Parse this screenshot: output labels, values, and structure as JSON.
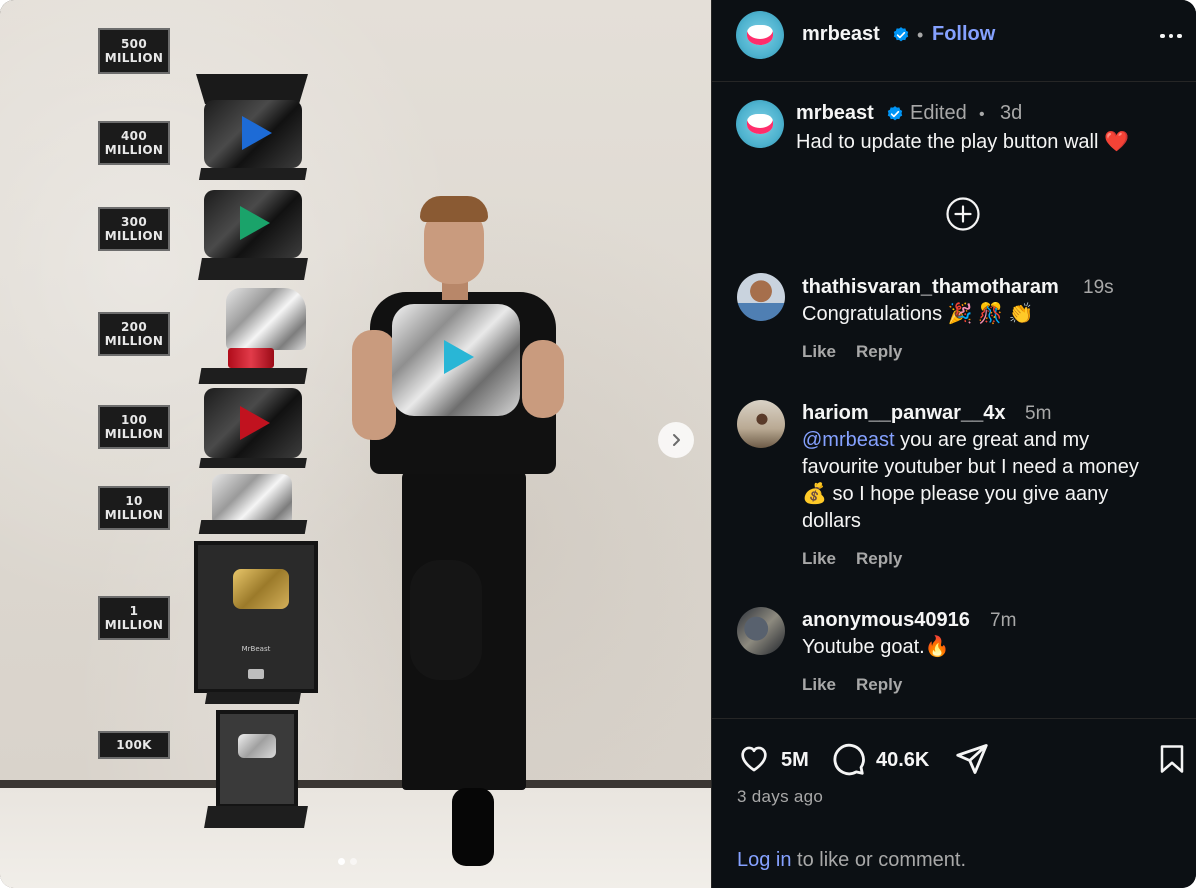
{
  "header": {
    "username": "mrbeast",
    "separator": "•",
    "follow_label": "Follow"
  },
  "media": {
    "plaques": [
      "500\nMILLION",
      "400\nMILLION",
      "300\nMILLION",
      "200\nMILLION",
      "100\nMILLION",
      "10\nMILLION",
      "1\nMILLION",
      "100K"
    ],
    "frame_label": "MrBeast",
    "slide_index": 1,
    "slide_count": 2
  },
  "caption": {
    "username": "mrbeast",
    "edited_label": "Edited",
    "separator": "•",
    "time": "3d",
    "text": "Had to update the play button wall ❤️"
  },
  "comments": [
    {
      "username": "thathisvaran_thamotharam",
      "time": "19s",
      "text": "Congratulations 🎉 🎊 👏",
      "like_label": "Like",
      "reply_label": "Reply"
    },
    {
      "username": "hariom__panwar__4x",
      "time": "5m",
      "mention": "@mrbeast",
      "text_line1": " you are great and my",
      "text_line2": "favourite youtuber but I need a money",
      "text_line3": "💰 so I hope please you give aany",
      "text_line4": "dollars",
      "like_label": "Like",
      "reply_label": "Reply"
    },
    {
      "username": "anonymous40916",
      "time": "7m",
      "text": "Youtube goat.🔥",
      "like_label": "Like",
      "reply_label": "Reply"
    }
  ],
  "actions": {
    "likes": "5M",
    "comments": "40.6K",
    "icons": [
      "heart-icon",
      "comment-icon",
      "share-icon",
      "bookmark-icon"
    ]
  },
  "date_label": "3 days ago",
  "login": {
    "link_label": "Log in",
    "rest_label": " to like or comment."
  },
  "colors": {
    "panel_bg": "#0c1014",
    "accent_link": "#85a1ff",
    "verified_blue": "#0095f6",
    "secondary_text": "#a8a8a8"
  }
}
